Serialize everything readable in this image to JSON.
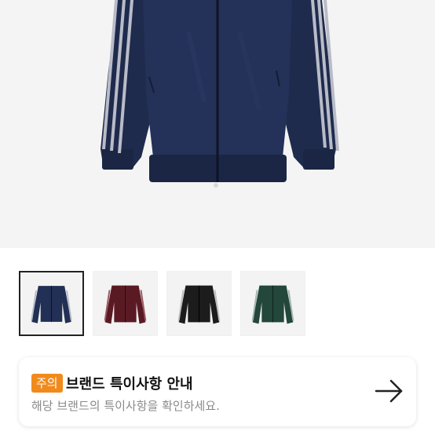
{
  "notice": {
    "badge": "주의",
    "title": "브랜드 특이사항 안내",
    "subtitle": "해당 브랜드의 특이사항을 확인하세요.",
    "arrow_icon": "arrow-right-icon"
  },
  "thumbnails": [
    {
      "color_name": "navy",
      "body": "#233055",
      "stripe": "#b9bcc8",
      "selected": true
    },
    {
      "color_name": "burgundy",
      "body": "#5a1a24",
      "stripe": "#9a5a63",
      "selected": false
    },
    {
      "color_name": "black",
      "body": "#1c1c1c",
      "stripe": "#bdbdbd",
      "selected": false
    },
    {
      "color_name": "green",
      "body": "#23473a",
      "stripe": "#a3b7ae",
      "selected": false
    }
  ],
  "colors": {
    "hero_background": "#f4f4f4",
    "jacket_navy": "#1f2b4d",
    "badge": "#f08a1c"
  }
}
